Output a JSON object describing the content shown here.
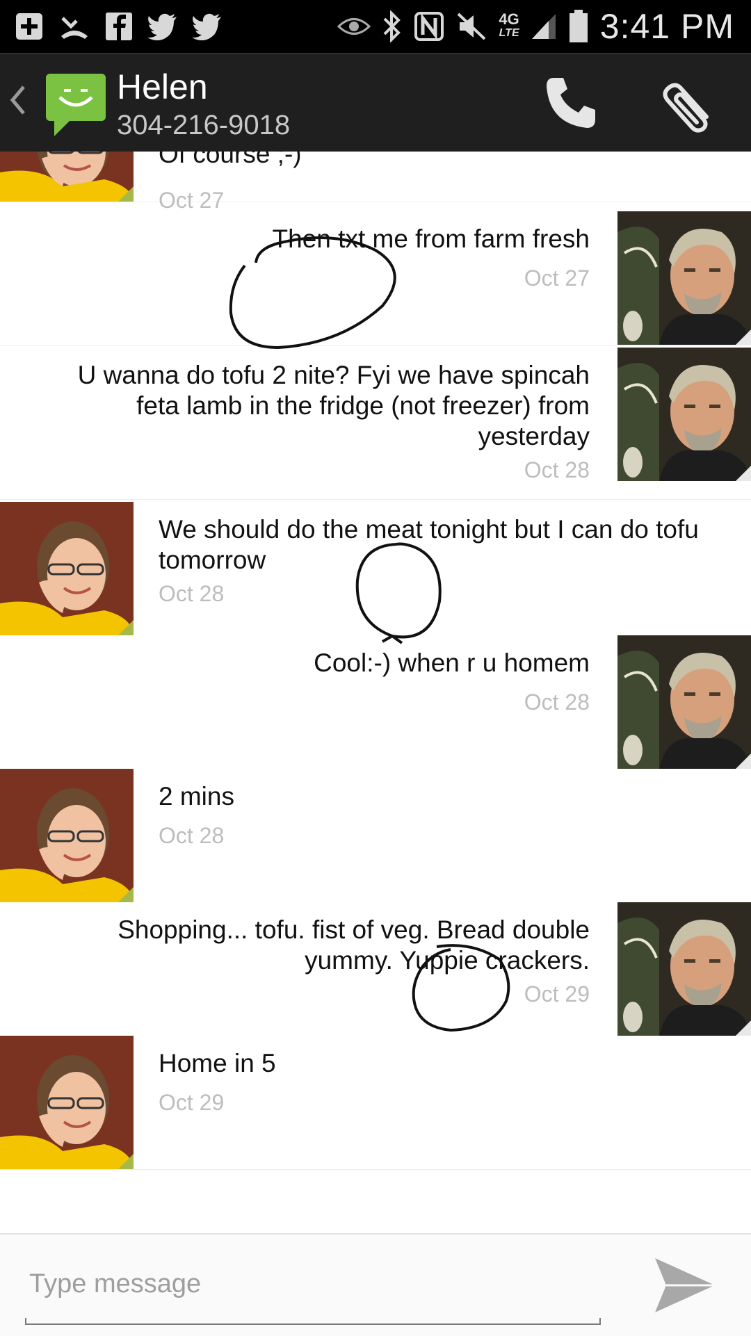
{
  "status_bar": {
    "time": "3:41 PM",
    "network": "4G",
    "network_sub": "LTE",
    "icons": [
      "plus-box-icon",
      "missed-call-icon",
      "facebook-icon",
      "twitter-icon",
      "twitter-icon",
      "eye-icon",
      "bluetooth-icon",
      "nfc-icon",
      "mute-icon",
      "signal-icon",
      "battery-icon"
    ]
  },
  "header": {
    "contact_name": "Helen",
    "phone": "304-216-9018",
    "icons": [
      "back-chevron-icon",
      "messaging-app-icon",
      "phone-icon",
      "paperclip-icon"
    ]
  },
  "messages": [
    {
      "dir": "recv",
      "text": "Of course ;-)",
      "date": "Oct 27"
    },
    {
      "dir": "sent",
      "text": "Then txt me from farm fresh",
      "date": "Oct 27"
    },
    {
      "dir": "sent",
      "text": "U wanna do tofu 2 nite? Fyi we have spincah feta lamb in the fridge (not freezer) from yesterday",
      "date": "Oct 28"
    },
    {
      "dir": "recv",
      "text": "We should do the meat tonight but I can do tofu tomorrow",
      "date": "Oct 28"
    },
    {
      "dir": "sent",
      "text": "Cool:-) when r u homem",
      "date": "Oct 28"
    },
    {
      "dir": "recv",
      "text": "2 mins",
      "date": "Oct 28"
    },
    {
      "dir": "sent",
      "text": "Shopping... tofu. fist of veg. Bread double yummy. Yuppie crackers.",
      "date": "Oct 29"
    },
    {
      "dir": "recv",
      "text": "Home in 5",
      "date": "Oct 29"
    }
  ],
  "composer": {
    "placeholder": "Type message",
    "send_icon": "send-icon"
  },
  "colors": {
    "status_bar": "#000000",
    "action_bar": "#1f1f1f",
    "app_icon_green": "#7cc242",
    "date_text": "#bdbdbd",
    "annotation_ink": "#111111"
  }
}
